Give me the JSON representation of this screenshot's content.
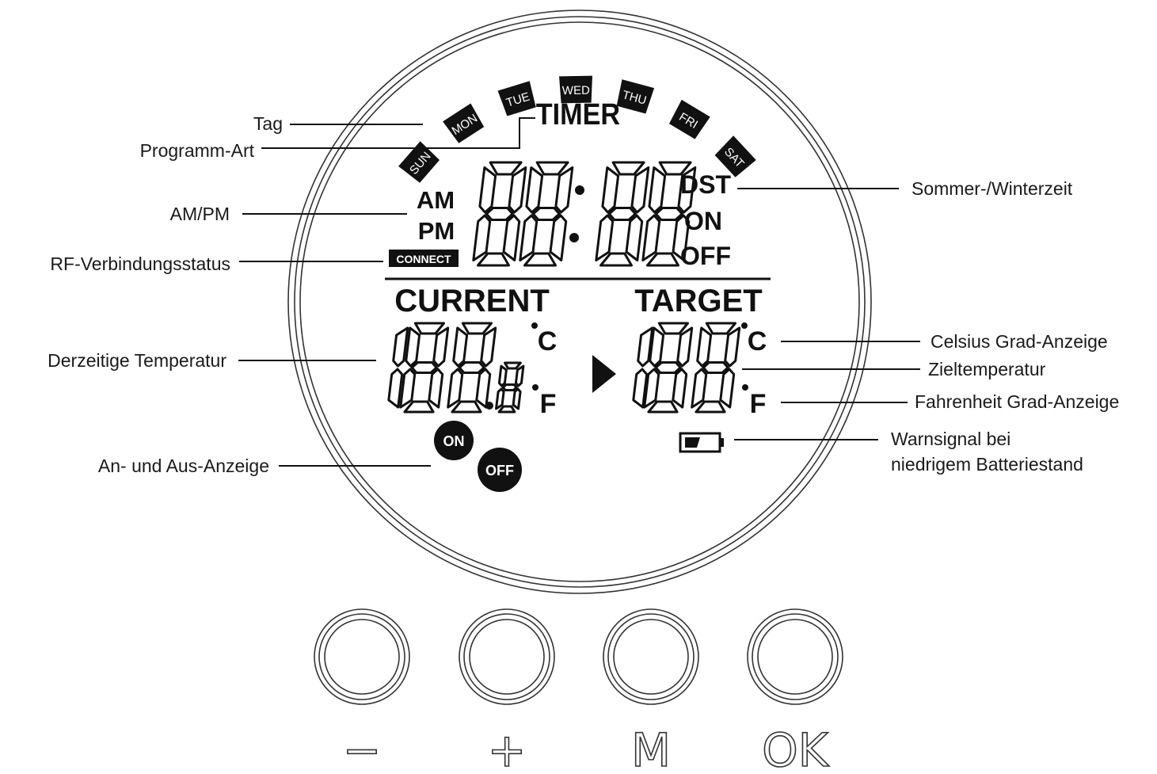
{
  "callouts": {
    "tag": "Tag",
    "programm_art": "Programm-Art",
    "am_pm": "AM/PM",
    "rf_status": "RF-Verbindungsstatus",
    "current_temp": "Derzeitige Temperatur",
    "on_off_indicator": "An- und Aus-Anzeige",
    "summer_winter": "Sommer-/Winterzeit",
    "celsius": "Celsius Grad-Anzeige",
    "target_temp": "Zieltemperatur",
    "fahrenheit": "Fahrenheit Grad-Anzeige",
    "battery_line1": "Warnsignal bei",
    "battery_line2": "niedrigem Batteriestand"
  },
  "display": {
    "days": [
      "SUN",
      "MON",
      "TUE",
      "WED",
      "THU",
      "FRI",
      "SAT"
    ],
    "timer": "TIMER",
    "am": "AM",
    "pm": "PM",
    "connect": "CONNECT",
    "dst": "DST",
    "on": "ON",
    "off": "OFF",
    "current": "CURRENT",
    "target": "TARGET",
    "celsius_unit": "C",
    "fahrenheit_unit": "F",
    "badge_on": "ON",
    "badge_off": "OFF"
  },
  "buttons": [
    {
      "symbol": "−",
      "name": "minus"
    },
    {
      "symbol": "+",
      "name": "plus"
    },
    {
      "symbol": "M",
      "name": "mode"
    },
    {
      "symbol": "OK",
      "name": "ok"
    }
  ],
  "colors": {
    "ink": "#111111",
    "background": "#ffffff"
  }
}
